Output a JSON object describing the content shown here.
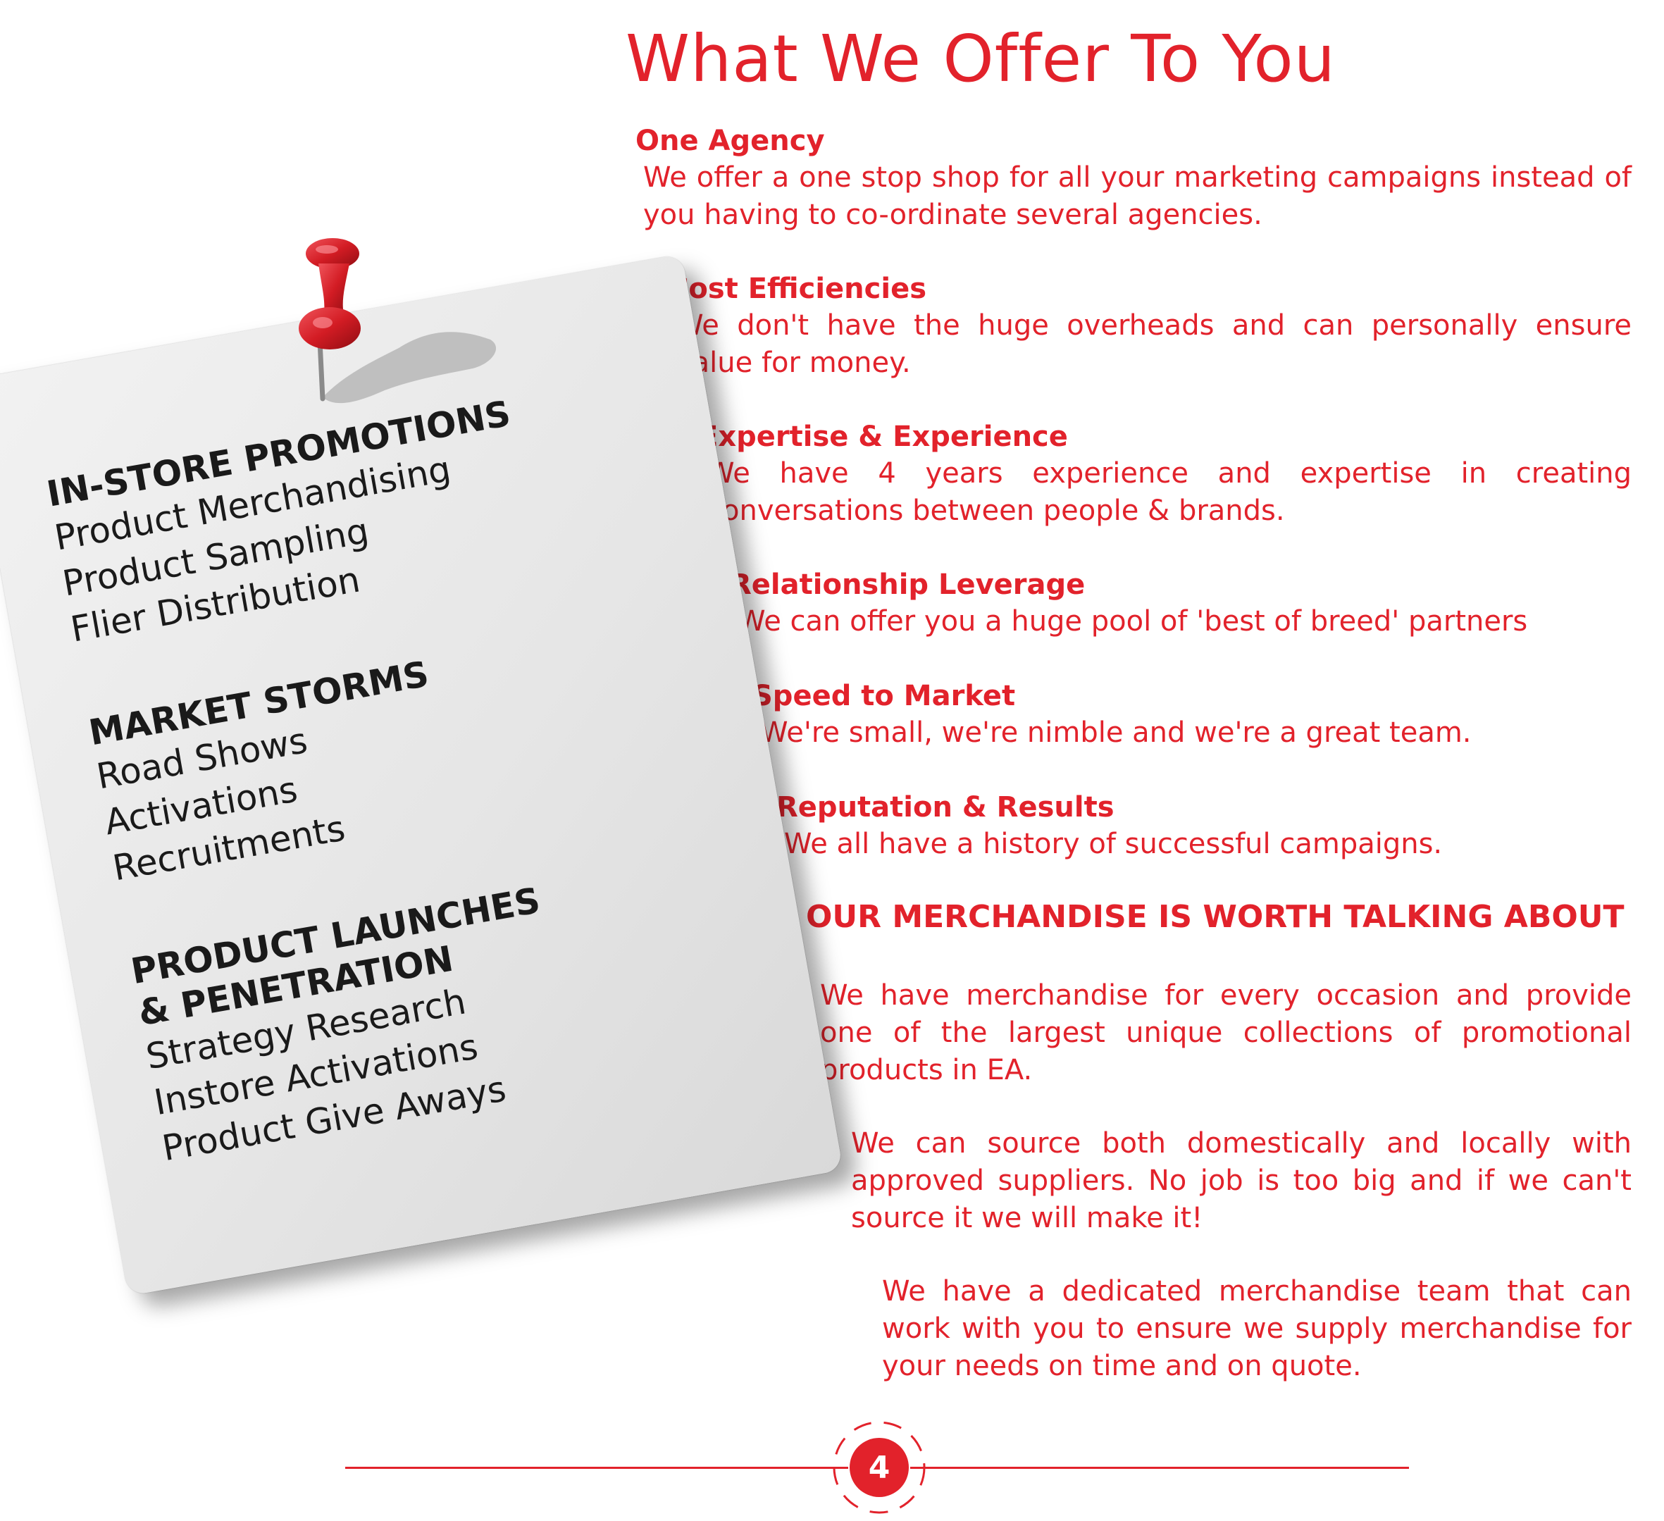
{
  "title": "What We Offer To You",
  "colors": {
    "accent": "#e2222b",
    "note_text": "#1a1a1a",
    "note_bg": "#e6e6e6"
  },
  "offers": [
    {
      "heading": "One Agency",
      "text": "We offer a one stop shop for all your marketing campaigns instead of you having to co-ordinate several agencies."
    },
    {
      "heading": "Cost Efficiencies",
      "text": "We don't have the huge overheads and can personally ensure value for money."
    },
    {
      "heading": "Expertise & Experience",
      "text": "We have 4 years experience and expertise in creating conversations between people & brands."
    },
    {
      "heading": "Relationship Leverage",
      "text": "We can offer you a huge pool of 'best of breed' partners"
    },
    {
      "heading": "Speed to Market",
      "text": "We're small, we're nimble and we're a great team."
    },
    {
      "heading": "Reputation & Results",
      "text": "We all have a history of successful campaigns."
    }
  ],
  "merchandise": {
    "heading": "OUR MERCHANDISE IS WORTH TALKING ABOUT",
    "paragraphs": [
      "We have merchandise for every occasion and provide one of the largest unique collections of promotional products in EA.",
      "We can source both domestically and locally with approved suppliers. No job is too big and if we can't source it we will make it!",
      "We have a dedicated merchandise team that can work with you to ensure we supply merchandise for your needs on time and on quote."
    ]
  },
  "note": {
    "sections": [
      {
        "heading": "IN-STORE PROMOTIONS",
        "items": [
          "Product Merchandising",
          "Product Sampling",
          "Flier Distribution"
        ]
      },
      {
        "heading": "MARKET STORMS",
        "items": [
          "Road Shows",
          "Activations",
          "Recruitments"
        ]
      },
      {
        "heading": "PRODUCT LAUNCHES & PENETRATION",
        "items": [
          "Strategy Research",
          "Instore Activations",
          "Product Give Aways"
        ]
      }
    ],
    "pin_icon": "push-pin-icon"
  },
  "footer": {
    "page_number": "4"
  }
}
